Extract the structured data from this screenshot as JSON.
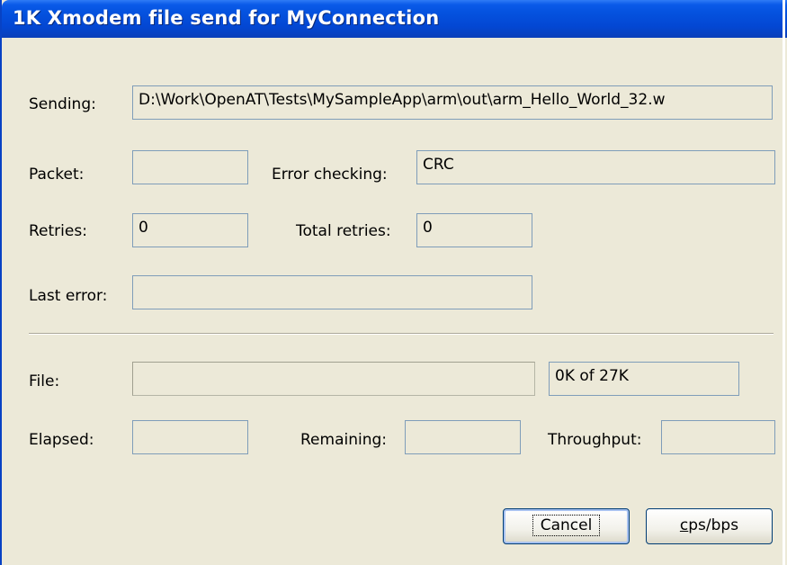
{
  "window": {
    "title": "1K Xmodem file send for MyConnection"
  },
  "transfer": {
    "sending_label": "Sending:",
    "sending_value": "D:\\Work\\OpenAT\\Tests\\MySampleApp\\arm\\out\\arm_Hello_World_32.w",
    "packet_label": "Packet:",
    "packet_value": "",
    "error_checking_label": "Error checking:",
    "error_checking_value": "CRC",
    "retries_label": "Retries:",
    "retries_value": "0",
    "total_retries_label": "Total retries:",
    "total_retries_value": "0",
    "last_error_label": "Last error:",
    "last_error_value": ""
  },
  "progress": {
    "file_label": "File:",
    "file_progress_fraction": 0,
    "file_size_value": "0K of 27K",
    "elapsed_label": "Elapsed:",
    "elapsed_value": "",
    "remaining_label": "Remaining:",
    "remaining_value": "",
    "throughput_label": "Throughput:",
    "throughput_value": ""
  },
  "buttons": {
    "cancel_label": "Cancel",
    "cps_bps_prefix_underlined": "c",
    "cps_bps_rest": "ps/bps"
  }
}
